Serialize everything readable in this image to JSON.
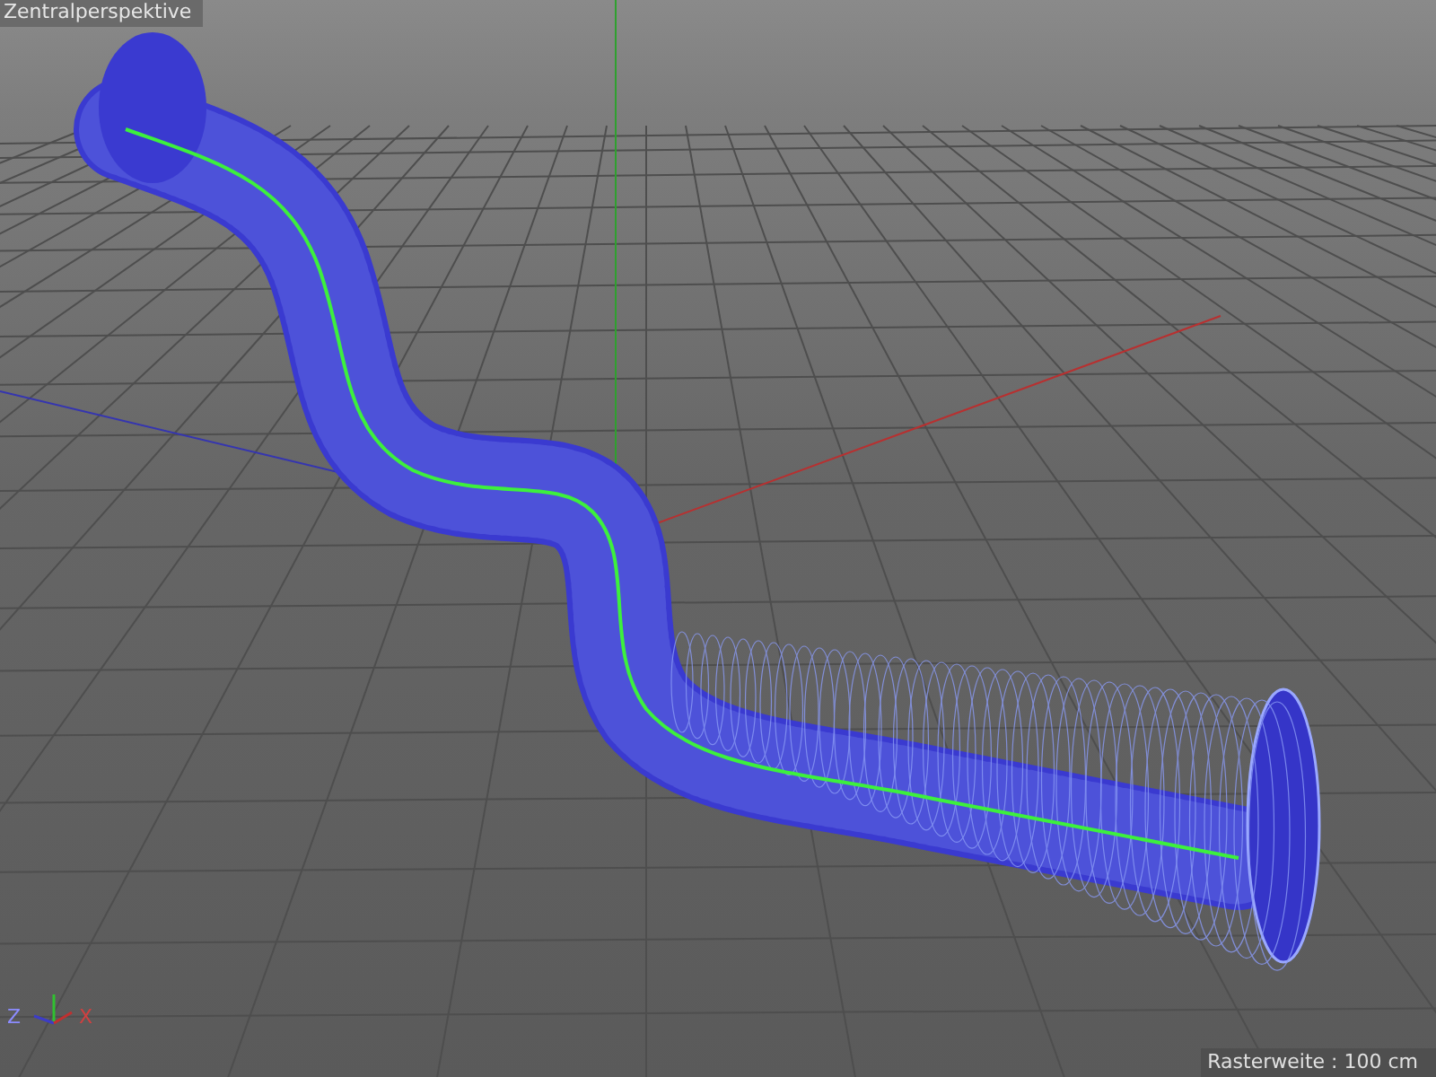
{
  "viewport": {
    "title": "Zentralperspektive",
    "grid_spacing": "Rasterweite : 100 cm"
  },
  "axis_gizmo": {
    "labels": [
      {
        "kind": "z",
        "text": "Z"
      },
      {
        "kind": "x",
        "text": "X"
      }
    ]
  }
}
